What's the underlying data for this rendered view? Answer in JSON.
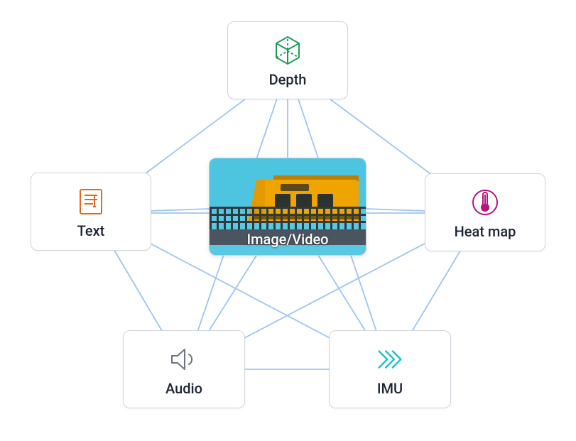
{
  "diagram": {
    "center": {
      "label": "Image/Video"
    },
    "nodes": {
      "depth": {
        "label": "Depth",
        "icon": "cube-icon",
        "color": "#1f9d55"
      },
      "text": {
        "label": "Text",
        "icon": "text-page-icon",
        "color": "#e06b1f"
      },
      "heatmap": {
        "label": "Heat map",
        "icon": "thermometer-icon",
        "color": "#b7127d"
      },
      "audio": {
        "label": "Audio",
        "icon": "speaker-icon",
        "color": "#6b7280"
      },
      "imu": {
        "label": "IMU",
        "icon": "arrows-icon",
        "color": "#19c2c2"
      }
    }
  }
}
